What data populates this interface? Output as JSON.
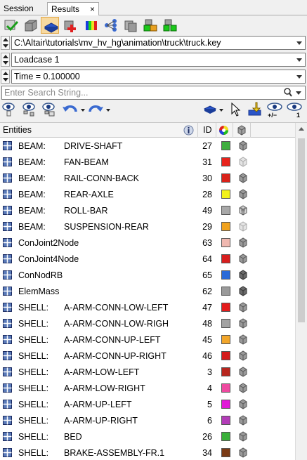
{
  "tabs": [
    {
      "label": "Session"
    },
    {
      "label": "Results",
      "close": "×"
    }
  ],
  "toolbar1": {
    "icons": [
      "check-icon",
      "model-icon",
      "part-list-icon",
      "add-component-icon",
      "contour-icon",
      "tree-icon",
      "collector-icon",
      "assembly-icon",
      "group-icon"
    ]
  },
  "file_path": "C:\\Altair\\tutorials\\mv_hv_hg\\animation\\truck\\truck.key",
  "loadcase": "Loadcase 1",
  "time": "Time = 0.100000",
  "search": {
    "placeholder": "Enter Search String..."
  },
  "toolbar2": {
    "icons": [
      "visibility-icon",
      "show-selected-icon",
      "show-all-icon",
      "undo-icon",
      "redo-icon",
      "display-mode-icon",
      "cursor-icon",
      "import-icon",
      "isolate-icon",
      "show-count-icon"
    ],
    "labels": {
      "plus_minus": "+/−",
      "one": "1"
    }
  },
  "table": {
    "headers": {
      "entities": "Entities",
      "id": "ID"
    },
    "rows": [
      {
        "type": "BEAM:",
        "name": "DRIVE-SHAFT",
        "id": "27",
        "color": "#3fae3f",
        "cube": "solid"
      },
      {
        "type": "BEAM:",
        "name": "FAN-BEAM",
        "id": "31",
        "color": "#e8231c",
        "cube": "light"
      },
      {
        "type": "BEAM:",
        "name": "RAIL-CONN-BACK",
        "id": "30",
        "color": "#d9221a",
        "cube": "solid"
      },
      {
        "type": "BEAM:",
        "name": "REAR-AXLE",
        "id": "28",
        "color": "#f2f21a",
        "cube": "solid"
      },
      {
        "type": "BEAM:",
        "name": "ROLL-BAR",
        "id": "49",
        "color": "#a8a8a8",
        "cube": "mesh"
      },
      {
        "type": "BEAM:",
        "name": "SUSPENSION-REAR",
        "id": "29",
        "color": "#f0a21e",
        "cube": "light"
      },
      {
        "type": "",
        "name": "ConJoint2Node",
        "id": "63",
        "color": "#f0b8b0",
        "cube": "solid"
      },
      {
        "type": "",
        "name": "ConJoint4Node",
        "id": "64",
        "color": "#d81e1e",
        "cube": "solid"
      },
      {
        "type": "",
        "name": "ConNodRB",
        "id": "65",
        "color": "#2a6ad8",
        "cube": "dark"
      },
      {
        "type": "",
        "name": "ElemMass",
        "id": "62",
        "color": "#9a9a9a",
        "cube": "dark"
      },
      {
        "type": "SHELL:",
        "name": "A-ARM-CONN-LOW-LEFT",
        "id": "47",
        "color": "#e41c1c",
        "cube": "solid"
      },
      {
        "type": "SHELL:",
        "name": "A-ARM-CONN-LOW-RIGH",
        "id": "48",
        "color": "#a2a2a2",
        "cube": "solid"
      },
      {
        "type": "SHELL:",
        "name": "A-ARM-CONN-UP-LEFT",
        "id": "45",
        "color": "#f2a62a",
        "cube": "solid"
      },
      {
        "type": "SHELL:",
        "name": "A-ARM-CONN-UP-RIGHT",
        "id": "46",
        "color": "#d41c1c",
        "cube": "solid"
      },
      {
        "type": "SHELL:",
        "name": "A-ARM-LOW-LEFT",
        "id": "3",
        "color": "#b8261e",
        "cube": "solid"
      },
      {
        "type": "SHELL:",
        "name": "A-ARM-LOW-RIGHT",
        "id": "4",
        "color": "#ee4aa0",
        "cube": "solid"
      },
      {
        "type": "SHELL:",
        "name": "A-ARM-UP-LEFT",
        "id": "5",
        "color": "#e21ad8",
        "cube": "solid"
      },
      {
        "type": "SHELL:",
        "name": "A-ARM-UP-RIGHT",
        "id": "6",
        "color": "#b33cb8",
        "cube": "solid"
      },
      {
        "type": "SHELL:",
        "name": "BED",
        "id": "26",
        "color": "#3ab03a",
        "cube": "solid"
      },
      {
        "type": "SHELL:",
        "name": "BRAKE-ASSEMBLY-FR.1",
        "id": "34",
        "color": "#7a3a14",
        "cube": "solid"
      }
    ]
  }
}
